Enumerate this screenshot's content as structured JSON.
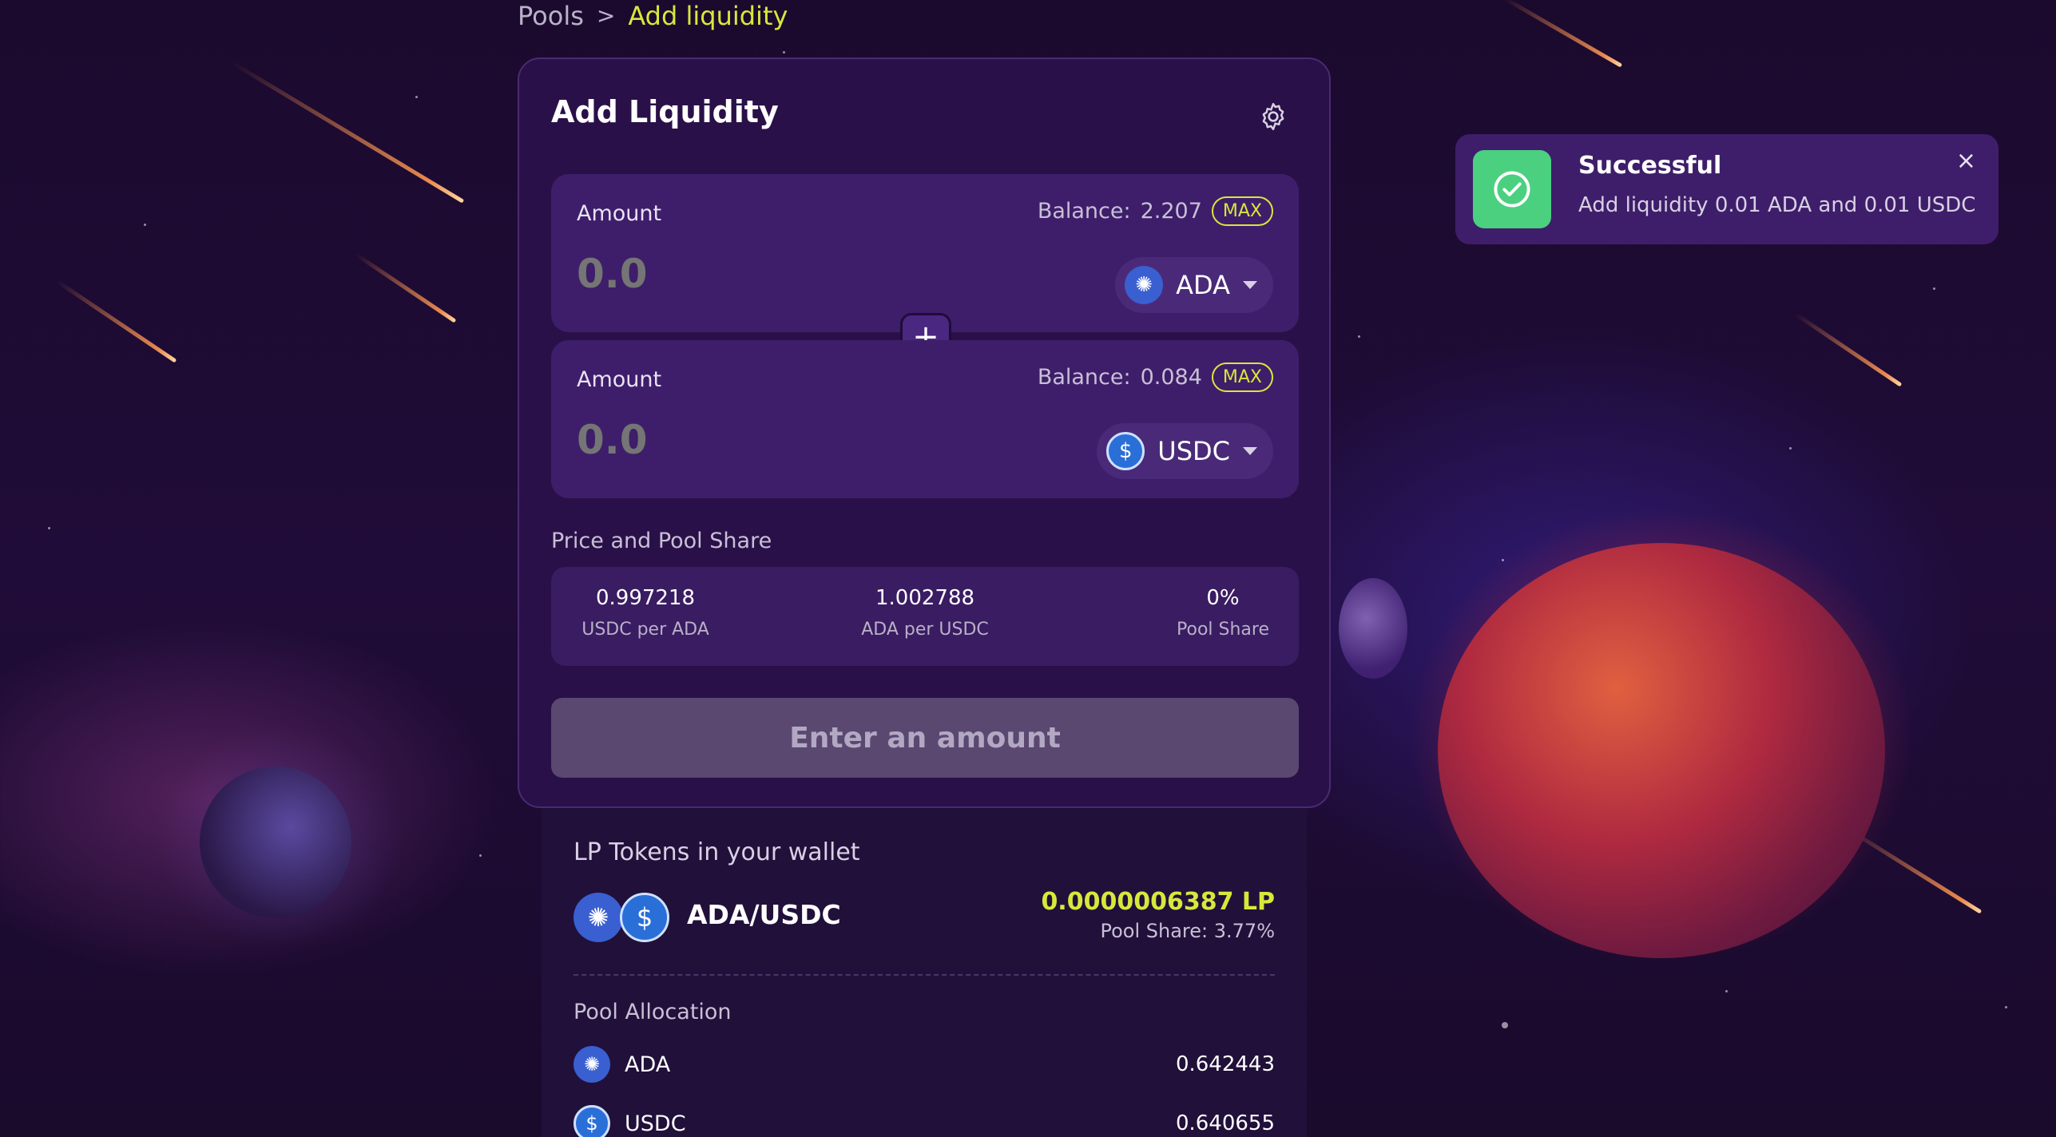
{
  "breadcrumb": {
    "parent": "Pools",
    "separator": ">",
    "current": "Add liquidity"
  },
  "card": {
    "title": "Add Liquidity",
    "inputs": [
      {
        "label": "Amount",
        "balance_label": "Balance:",
        "balance": "2.207",
        "max": "MAX",
        "placeholder": "0.0",
        "token": "ADA"
      },
      {
        "label": "Amount",
        "balance_label": "Balance:",
        "balance": "0.084",
        "max": "MAX",
        "placeholder": "0.0",
        "token": "USDC"
      }
    ],
    "plus": "+",
    "price_title": "Price and Pool Share",
    "stats": [
      {
        "value": "0.997218",
        "label": "USDC per ADA"
      },
      {
        "value": "1.002788",
        "label": "ADA per USDC"
      },
      {
        "value": "0%",
        "label": "Pool Share"
      }
    ],
    "submit": "Enter an amount"
  },
  "lp": {
    "title": "LP Tokens in your wallet",
    "pair": "ADA/USDC",
    "amount": "0.0000006387 LP",
    "share": "Pool Share:  3.77%",
    "alloc_title": "Pool Allocation",
    "allocations": [
      {
        "token": "ADA",
        "value": "0.642443"
      },
      {
        "token": "USDC",
        "value": "0.640655"
      }
    ]
  },
  "toast": {
    "title": "Successful",
    "message": "Add liquidity 0.01 ADA and 0.01 USDC",
    "close": "×"
  },
  "colors": {
    "accent": "#d8e83a",
    "success": "#4bd080",
    "card": "#2a1048",
    "panel": "#3e1e6a"
  },
  "icons": {
    "settings": "gear-icon",
    "ada": "ada-token-icon",
    "usdc": "usdc-token-icon",
    "success": "check-circle-icon",
    "close": "close-icon",
    "dropdown": "chevron-down-icon"
  }
}
